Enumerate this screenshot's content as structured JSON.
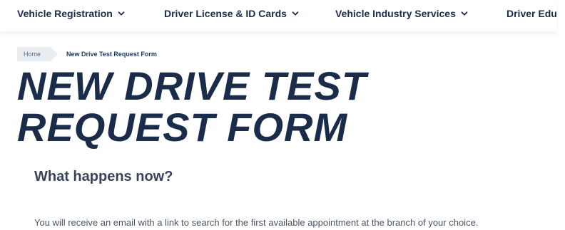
{
  "nav": {
    "items": [
      {
        "label": "Vehicle Registration",
        "icon": "chevron-down-icon"
      },
      {
        "label": "Driver License & ID Cards",
        "icon": "chevron-down-icon"
      },
      {
        "label": "Vehicle Industry Services",
        "icon": "chevron-down-icon"
      },
      {
        "label": "Driver Edu"
      }
    ]
  },
  "breadcrumb": {
    "home": "Home",
    "current": "New Drive Test Request Form"
  },
  "page": {
    "title_line1": "NEW DRIVE TEST",
    "title_line2": "REQUEST FORM",
    "subheading": "What happens now?",
    "body": "You will receive an email with a link to search for the first available appointment at the branch of your choice."
  },
  "colors": {
    "brand_navy": "#1b2b4a",
    "breadcrumb_bg": "#eaeef3",
    "body_text": "#4a5568"
  }
}
